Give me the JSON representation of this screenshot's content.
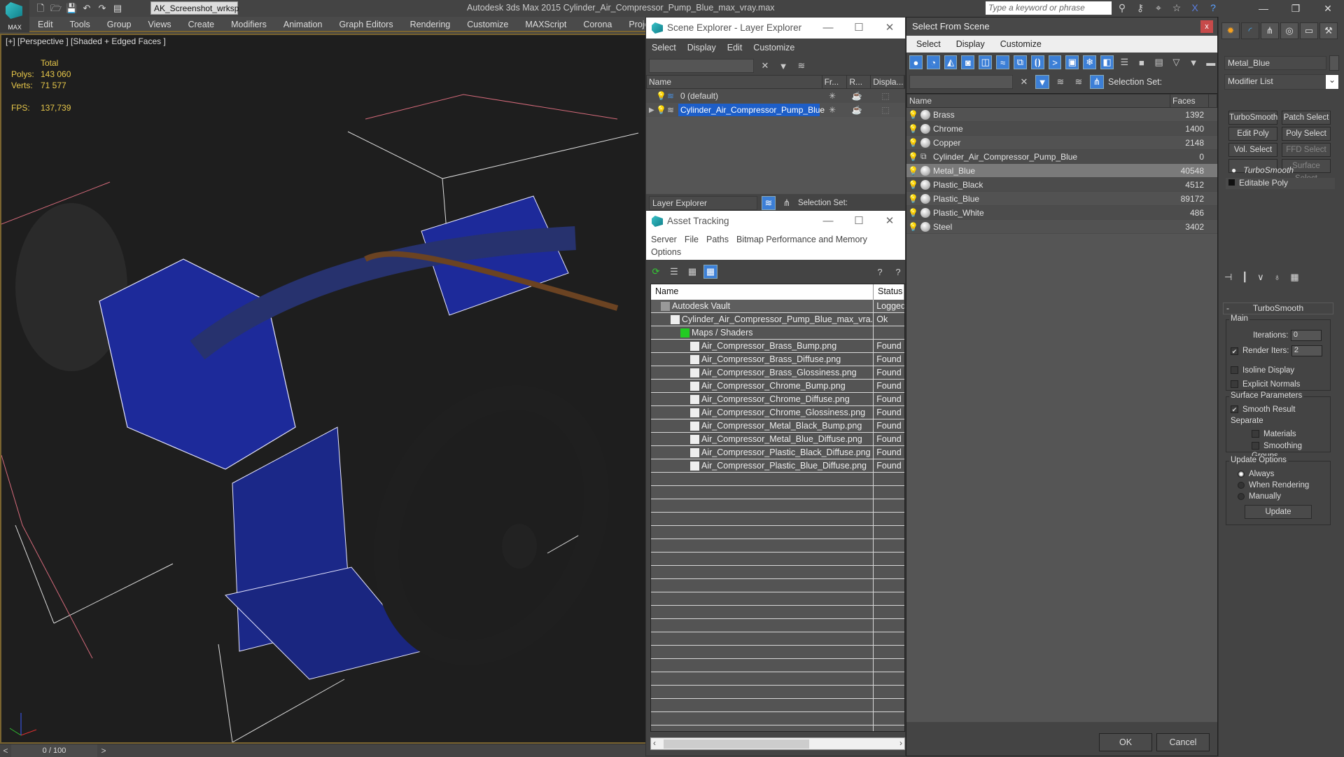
{
  "app": {
    "logo_label": "MAX",
    "workspace": "AK_Screenshot_wrksp",
    "title": "Autodesk 3ds Max  2015     Cylinder_Air_Compressor_Pump_Blue_max_vray.max",
    "search_placeholder": "Type a keyword or phrase"
  },
  "menu": [
    "Edit",
    "Tools",
    "Group",
    "Views",
    "Create",
    "Modifiers",
    "Animation",
    "Graph Editors",
    "Rendering",
    "Customize",
    "MAXScript",
    "Corona",
    "Project Man..."
  ],
  "viewport": {
    "label": "[+] [Perspective ] [Shaded + Edged Faces ]",
    "stats": {
      "total_label": "Total",
      "polys_label": "Polys:",
      "polys": "143 060",
      "verts_label": "Verts:",
      "verts": "71 577",
      "fps_label": "FPS:",
      "fps": "137,739"
    }
  },
  "timeline": {
    "position": "0 / 100",
    "prev": "<",
    "next": ">"
  },
  "scene_explorer": {
    "title": "Scene Explorer - Layer Explorer",
    "menu": [
      "Select",
      "Display",
      "Edit",
      "Customize"
    ],
    "columns": [
      "Name",
      "Fr...",
      "R...",
      "Displa..."
    ],
    "rows": [
      {
        "name": "0 (default)",
        "selected": false
      },
      {
        "name": "Cylinder_Air_Compressor_Pump_Blue",
        "selected": true
      }
    ],
    "footer_dropdown": "Layer Explorer",
    "selection_set_label": "Selection Set:"
  },
  "asset_tracking": {
    "title": "Asset Tracking",
    "menu": [
      "Server",
      "File",
      "Paths",
      "Bitmap Performance and Memory",
      "Options"
    ],
    "columns": [
      "Name",
      "Status"
    ],
    "rows": [
      {
        "name": "Autodesk Vault",
        "status": "Logged",
        "indent": 1
      },
      {
        "name": "Cylinder_Air_Compressor_Pump_Blue_max_vra...",
        "status": "Ok",
        "indent": 2
      },
      {
        "name": "Maps / Shaders",
        "status": "",
        "indent": 3
      },
      {
        "name": "Air_Compressor_Brass_Bump.png",
        "status": "Found",
        "indent": 4
      },
      {
        "name": "Air_Compressor_Brass_Diffuse.png",
        "status": "Found",
        "indent": 4
      },
      {
        "name": "Air_Compressor_Brass_Glossiness.png",
        "status": "Found",
        "indent": 4
      },
      {
        "name": "Air_Compressor_Chrome_Bump.png",
        "status": "Found",
        "indent": 4
      },
      {
        "name": "Air_Compressor_Chrome_Diffuse.png",
        "status": "Found",
        "indent": 4
      },
      {
        "name": "Air_Compressor_Chrome_Glossiness.png",
        "status": "Found",
        "indent": 4
      },
      {
        "name": "Air_Compressor_Metal_Black_Bump.png",
        "status": "Found",
        "indent": 4
      },
      {
        "name": "Air_Compressor_Metal_Blue_Diffuse.png",
        "status": "Found",
        "indent": 4
      },
      {
        "name": "Air_Compressor_Plastic_Black_Diffuse.png",
        "status": "Found",
        "indent": 4
      },
      {
        "name": "Air_Compressor_Plastic_Blue_Diffuse.png",
        "status": "Found",
        "indent": 4
      }
    ]
  },
  "select_from_scene": {
    "title": "Select From Scene",
    "close": "x",
    "menu": [
      "Select",
      "Display",
      "Customize"
    ],
    "selection_set_label": "Selection Set:",
    "columns": [
      "Name",
      "Faces"
    ],
    "rows": [
      {
        "name": "Brass",
        "faces": "1392"
      },
      {
        "name": "Chrome",
        "faces": "1400"
      },
      {
        "name": "Copper",
        "faces": "2148"
      },
      {
        "name": "Cylinder_Air_Compressor_Pump_Blue",
        "faces": "0"
      },
      {
        "name": "Metal_Blue",
        "faces": "40548",
        "highlight": true
      },
      {
        "name": "Plastic_Black",
        "faces": "4512"
      },
      {
        "name": "Plastic_Blue",
        "faces": "89172"
      },
      {
        "name": "Plastic_White",
        "faces": "486"
      },
      {
        "name": "Steel",
        "faces": "3402"
      }
    ],
    "ok": "OK",
    "cancel": "Cancel"
  },
  "command_panel": {
    "object_name": "Metal_Blue",
    "modifier_list": "Modifier List",
    "modifier_buttons": [
      "TurboSmooth",
      "Patch Select",
      "Edit Poly",
      "Poly Select",
      "Vol. Select",
      "FFD Select",
      "",
      "Surface Select"
    ],
    "stack": [
      "TurboSmooth",
      "Editable Poly"
    ],
    "turbosmooth": {
      "title": "TurboSmooth",
      "main_label": "Main",
      "iterations_label": "Iterations:",
      "iterations": "0",
      "render_iters_label": "Render Iters:",
      "render_iters": "2",
      "render_iters_checked": true,
      "isoline_label": "Isoline Display",
      "explicit_normals_label": "Explicit Normals",
      "surface_label": "Surface Parameters",
      "smooth_result_label": "Smooth Result",
      "separate_label": "Separate",
      "materials_label": "Materials",
      "smoothing_groups_label": "Smoothing Groups",
      "update_options_label": "Update Options",
      "always_label": "Always",
      "when_rendering_label": "When Rendering",
      "manually_label": "Manually",
      "update_button": "Update"
    }
  }
}
